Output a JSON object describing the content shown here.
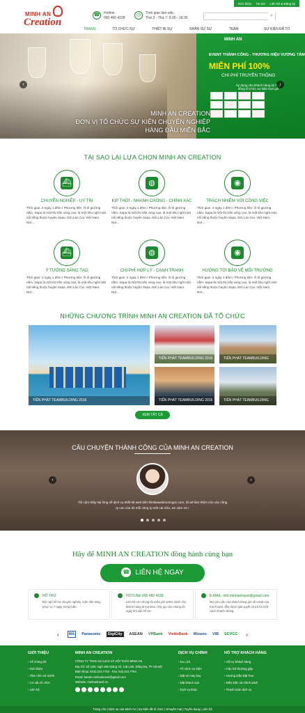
{
  "topbar": {
    "links": [
      "Giới thiệu",
      "Tin tức",
      "Liên hệ & Đăng ký"
    ]
  },
  "header": {
    "logo_line1": "MINH AN",
    "logo_line2": "Creation",
    "hotline_label": "Hotline",
    "hotline_value": "090 460 4228",
    "hours_label": "Thời gian làm việc",
    "hours_value": "Thứ 2 - Thứ 7: 8.00 - 18.00"
  },
  "nav": [
    "TRANG CHỦ",
    "TỔ CHỨC SỰ KIỆN",
    "THIẾT BỊ SỰ KIỆN",
    "NHÂN SỰ SỰ KIỆN",
    "TEAM BUILDING",
    "SỰ KIỆN ĐÃ TỔ CHỨC"
  ],
  "hero": {
    "promo_logo": "MINH AN",
    "promo_line1": "EVENT THÀNH CÔNG - THƯƠNG HIỆU VƯƠNG TẦM",
    "promo_line2": "MIỄN PHÍ 100%",
    "promo_line3": "CHI PHÍ TRUYỀN THÔNG",
    "promo_line4": "Áp dụng cho khách hàng ký hợp đồng tổ chức sự kiện trọn gói",
    "caption1": "MINH AN CREATION",
    "caption2": "ĐƠN VỊ TỔ CHỨC SỰ KIỆN CHUYÊN NGHIỆP",
    "caption3": "HÀNG ĐẦU MIỀN BẮC"
  },
  "why": {
    "title": "TẠI SAO LẠI LỰA CHỌN  MINH AN CREATION",
    "desc": "Thời gian: 2 ngày 1 đêm / Phương tiện: Ô tô giường nằm.  Sapa là một thị trấn vùng cao, là một khu nghỉ mát nổi tiếng thuộc huyện Sapa, tỉnh Lào Cai, Việt Nam. Nơi...",
    "items": [
      {
        "title": "CHUYÊN NGHIỆP - UY TÍN",
        "icon": "ship"
      },
      {
        "title": "KỊP THỜI - NHANH CHÓNG - CHÍNH XÁC",
        "icon": "planet"
      },
      {
        "title": "TRÁCH NHIỆM VỚI CÔNG VIỆC",
        "icon": "camera"
      },
      {
        "title": "Ý TƯỞNG SÁNG TẠO",
        "icon": "ship"
      },
      {
        "title": "CHI PHÍ HỢP LÝ - CẠNH TRANH",
        "icon": "planet"
      },
      {
        "title": "HƯỚNG TỚI BẢO VỆ MÔI TRƯỜNG",
        "icon": "camera"
      }
    ]
  },
  "programs": {
    "title": "NHỮNG CHƯƠNG TRÌNH  MINH AN CREATION ĐÃ TỔ CHỨC",
    "items": [
      "TIẾN PHÁT TEAMBUILDING 2016",
      "TIẾN PHÁT TEAMBUILDING 2016",
      "TIẾN PHÁT TEAMBUILDING 2016",
      "TIẾN PHÁT TEAMBUILDING 2016",
      "TIẾN PHÁT TEAMBUILDING 2016"
    ],
    "view_all": "XEM TẤT CẢ"
  },
  "story": {
    "title": "CÂU CHUYỆN THÀNH CÔNG CỦA  MINH AN CREATION",
    "quote": "Tôi cảm thấy hài lòng về dịch vụ thiết kế web bên thietkewebmonngoc.com, tôi sẽ làm thêm cho các công ty con của tôi mỗi công ty một cái nữa, xin cảm ơn !"
  },
  "cta": {
    "title": "Hãy để  MINH AN CREATION đồng hành  cùng bạn",
    "button": "LIÊN HỆ NGAY"
  },
  "support": [
    {
      "title": "HỖ TRỢ",
      "desc": "Đội ngũ hỗ trợ chuyên nghiệp, luôn sẵn sàng phục vụ 7 ngày trong tuần."
    },
    {
      "title": "HOTLINE 090 460 4228",
      "desc": "Liên hệ với chúng tôi miễn phí 100% dành cho khách hàng là Kontran. Hãy gọi cho chúng tôi ngay khi cần hỗ trợ."
    },
    {
      "title": "E-MAIL: info.minhantravel@gmail.com",
      "desc": "Mọi yêu cầu của khách hàng gửi về email của KonTravel, đều được giải quyết và trả lời một cách nhanh chóng."
    }
  ],
  "partners": [
    "MA",
    "Panasonic",
    "DigiCity",
    "ASEAN",
    "VPBank",
    "VietinBank",
    "Mizuno",
    "VIB",
    "SCVCC"
  ],
  "footer": {
    "col1_title": "GIỚI THIỆU",
    "col1_items": [
      "Về chúng tôi",
      "Giới thiệu",
      "Tầm nhìn và mệnh",
      "Cơ cấu tổ chức",
      "Liên hệ"
    ],
    "col2_title": "MINH AN CREATION",
    "col2_lines": [
      "CÔNG TY TNHH DU LỊCH VÀ HỘI THẢO MINH AN",
      "Địa chỉ: Số 33/8, Ngõ 189 Giảng Võ, Cát Linh, Đống Đa, TP Hà Nội",
      "Điện thoại: 0243.224.7754 - Fax: 043.224.7754",
      "Email: bantin.minhantravel@gmail.com",
      "Website: minhantravel.vn"
    ],
    "col3_title": "DỊCH VỤ CHÍNH",
    "col3_items": [
      "Du Lịch",
      "Tổ chức sự kiện",
      "Đặt vé máy bay",
      "Đặt khách sạn",
      "Dịch vụ khác"
    ],
    "col4_title": "HỖ TRỢ KHÁCH HÀNG",
    "col4_items": [
      "Hỗ trợ khách hàng",
      "Câu hỏi thường gặp",
      "Hướng Dẫn Đặt Tour",
      "Điều kiện và chính sách",
      "Thanh toán dịch vụ"
    ],
    "bottom": "Trang chủ  |  Dịch vụ của Minh An  |  Sự kiện đã tổ chức  |  Khuyến mại  |  Tuyển dụng  |  Liên hệ"
  }
}
